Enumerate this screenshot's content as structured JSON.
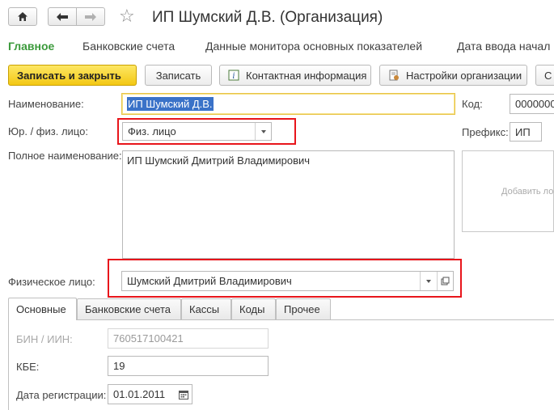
{
  "window": {
    "title": "ИП Шумский Д.В. (Организация)"
  },
  "icons": {
    "home": "home-icon",
    "back": "arrow-left-icon",
    "forward": "arrow-right-icon",
    "favorite": "star-icon",
    "info": "info-icon",
    "settings": "document-settings-icon",
    "calendar": "calendar-icon",
    "open": "open-window-icon"
  },
  "sections": [
    {
      "label": "Главное",
      "active": true
    },
    {
      "label": "Банковские счета"
    },
    {
      "label": "Данные монитора основных показателей"
    },
    {
      "label": "Дата ввода начал"
    }
  ],
  "toolbar": {
    "save_close": "Записать и закрыть",
    "save": "Записать",
    "contact_info": "Контактная информация",
    "org_settings": "Настройки организации",
    "more": "С"
  },
  "form": {
    "name_label": "Наименование:",
    "name_value": "ИП Шумский Д.В.",
    "code_label": "Код:",
    "code_value": "0000000",
    "legal_label": "Юр. / физ. лицо:",
    "legal_value": "Физ. лицо",
    "prefix_label": "Префикс:",
    "prefix_value": "ИП",
    "fullname_label": "Полное наименование:",
    "fullname_value": "ИП Шумский Дмитрий Владимирович",
    "logo_placeholder": "Добавить лого",
    "person_label": "Физическое лицо:",
    "person_value": "Шумский Дмитрий Владимирович"
  },
  "tabs": [
    {
      "label": "Основные",
      "active": true
    },
    {
      "label": "Банковские счета"
    },
    {
      "label": "Кассы"
    },
    {
      "label": "Коды"
    },
    {
      "label": "Прочее"
    }
  ],
  "main_tab": {
    "bin_label": "БИН / ИИН:",
    "bin_value": "760517100421",
    "kbe_label": "КБЕ:",
    "kbe_value": "19",
    "reg_date_label": "Дата регистрации:",
    "reg_date_value": "01.01.2011"
  },
  "colors": {
    "accent_green": "#3b9a3b",
    "primary_button": "#f3c814",
    "highlight_red": "#e8151b",
    "selection_blue": "#3a72c8"
  }
}
